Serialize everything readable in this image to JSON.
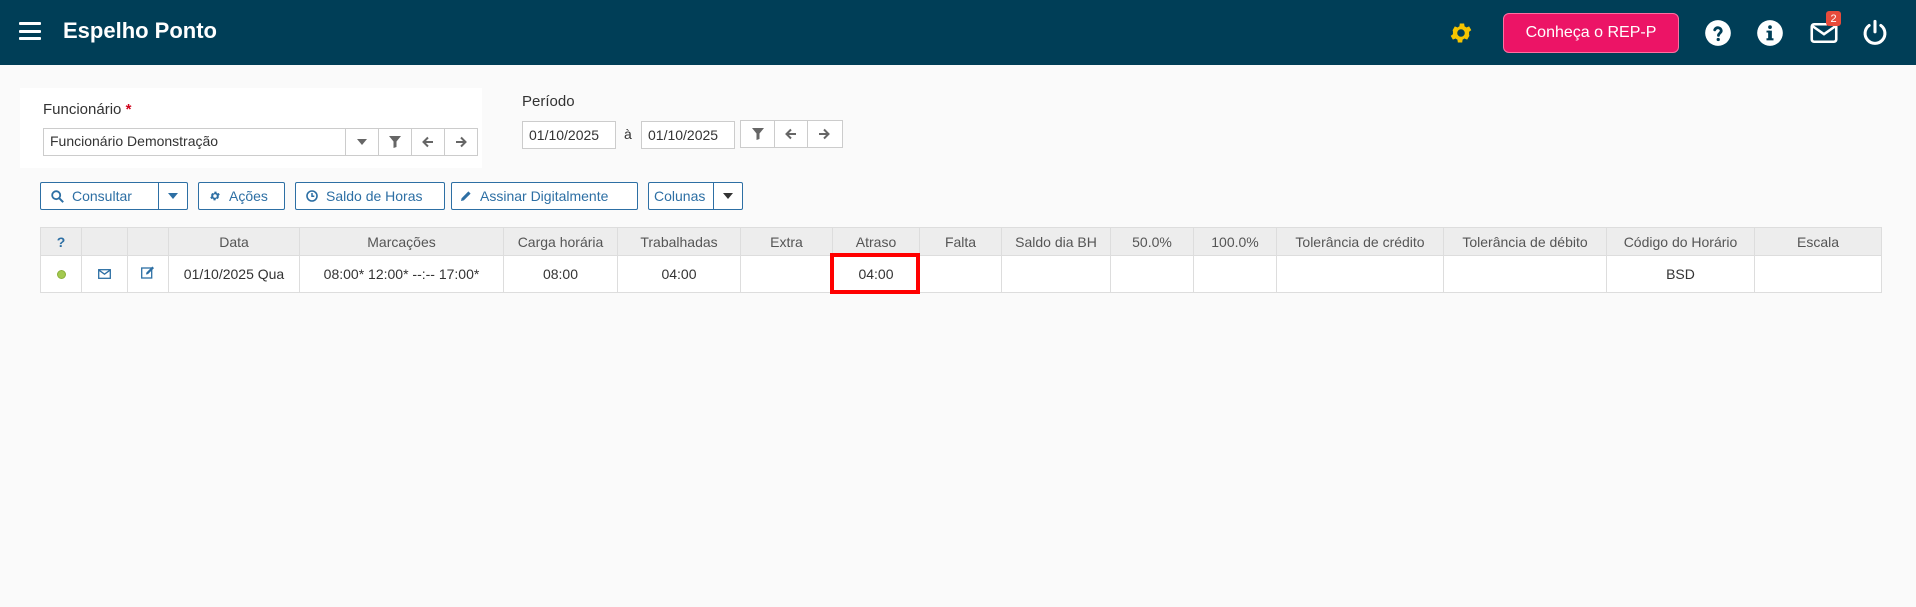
{
  "header": {
    "title": "Espelho Ponto",
    "rep_button_label": "Conheça o REP-P",
    "mail_badge_count": "2",
    "icons": [
      "menu-icon",
      "gear-icon",
      "help-icon",
      "info-icon",
      "mail-icon",
      "power-icon"
    ],
    "colors": {
      "bar": "#003e57",
      "accent": "#ec1466",
      "gear": "#f5c400"
    }
  },
  "filters": {
    "funcionario_label": "Funcionário",
    "required_mark": "*",
    "funcionario_value": "Funcionário Demonstração",
    "periodo_label": "Período",
    "date_from": "01/10/2025",
    "date_sep": "à",
    "date_to": "01/10/2025"
  },
  "toolbar": {
    "consultar": "Consultar",
    "acoes": "Ações",
    "saldo_horas": "Saldo de Horas",
    "assinar": "Assinar Digitalmente",
    "colunas": "Colunas"
  },
  "table": {
    "help_header": "?",
    "headers": [
      "Data",
      "Marcações",
      "Carga horária",
      "Trabalhadas",
      "Extra",
      "Atraso",
      "Falta",
      "Saldo dia BH",
      "50.0%",
      "100.0%",
      "Tolerância de crédito",
      "Tolerância de débito",
      "Código do Horário",
      "Escala"
    ],
    "rows": [
      {
        "status": "ok",
        "data": "01/10/2025 Qua",
        "marcacoes": "08:00* 12:00* --:-- 17:00*",
        "carga": "08:00",
        "trabalhadas": "04:00",
        "extra": "",
        "atraso": "04:00",
        "falta": "",
        "saldo_bh": "",
        "p50": "",
        "p100": "",
        "tol_credito": "",
        "tol_debito": "",
        "codigo": "BSD",
        "escala": ""
      }
    ]
  }
}
